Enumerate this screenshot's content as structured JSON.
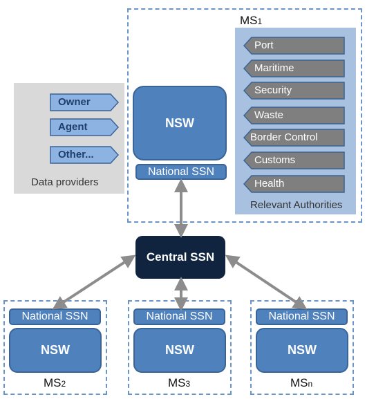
{
  "ms1": {
    "label_main": "MS",
    "label_sub": "1",
    "nsw": "NSW",
    "national_ssn": "National SSN"
  },
  "data_providers": {
    "caption": "Data providers",
    "items": [
      "Owner",
      "Agent",
      "Other..."
    ]
  },
  "authorities": {
    "caption": "Relevant Authorities",
    "items": [
      "Port",
      "Maritime",
      "Security",
      "Waste",
      "Border Control",
      "Customs",
      "Health"
    ]
  },
  "central": {
    "label": "Central SSN"
  },
  "members": [
    {
      "label_main": "MS",
      "label_sub": "2",
      "nsw": "NSW",
      "national_ssn": "National SSN"
    },
    {
      "label_main": "MS",
      "label_sub": "3",
      "nsw": "NSW",
      "national_ssn": "National SSN"
    },
    {
      "label_main": "MS",
      "label_sub": "n",
      "nsw": "NSW",
      "national_ssn": "National SSN"
    }
  ],
  "colors": {
    "nsw_blue": "#4f81bd",
    "central_navy": "#10233f",
    "authority_gray": "#7f7f7f",
    "provider_blue": "#8db3e2",
    "arrow_gray": "#8c8c8c",
    "dashed_border": "#6a93c8"
  }
}
